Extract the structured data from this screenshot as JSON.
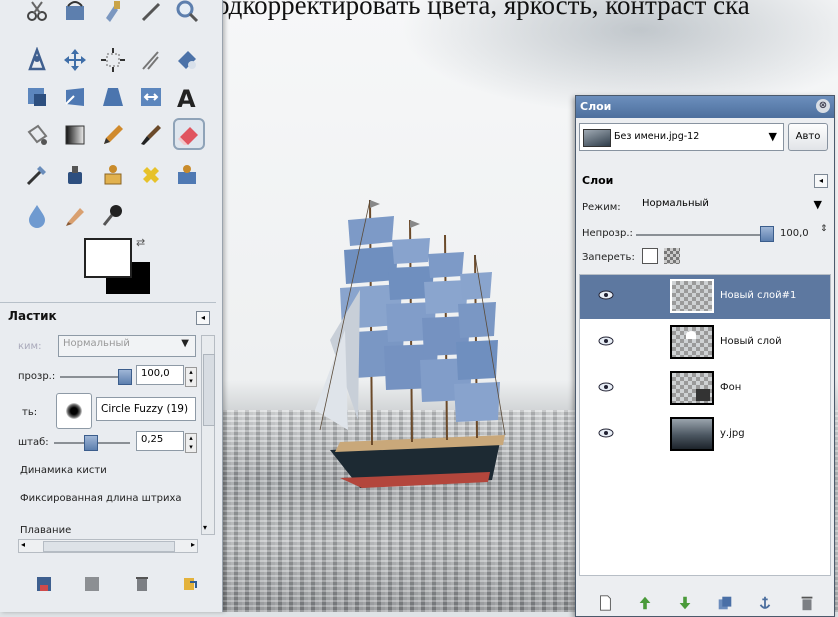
{
  "caption": "еще подкорректировать цвета, яркость, контраст ска",
  "tool_options": {
    "title": "Ластик",
    "mode_label": "ким:",
    "mode_value": "Нормальный",
    "opacity_label": "прозр.:",
    "opacity_value": "100,0",
    "brush_label": "ть:",
    "brush_value": "Circle Fuzzy (19)",
    "scale_label": "штаб:",
    "scale_value": "0,25",
    "dynamics_label": "Динамика кисти",
    "stroke_label": "Фиксированная длина штриха",
    "next_label": "Плавание"
  },
  "layers_dialog": {
    "title": "Слои",
    "image_name": "Без имени.jpg-12",
    "auto_button": "Авто",
    "section_title": "Слои",
    "mode_label": "Режим:",
    "mode_value": "Нормальный",
    "opacity_label": "Непрозр.:",
    "opacity_value": "100,0",
    "lock_label": "Запереть:",
    "layers": [
      {
        "name": "Новый слой#1",
        "selected": true
      },
      {
        "name": "Новый слой",
        "selected": false
      },
      {
        "name": "Фон",
        "selected": false
      },
      {
        "name": "у.jpg",
        "selected": false
      }
    ]
  },
  "colors": {
    "accent": "#5d78a0",
    "title_bar": "#4d6f9d",
    "eraser_highlight": "#e05560"
  },
  "icons": {
    "toolbox": [
      "scissors-icon",
      "paths-icon",
      "color-picker-icon",
      "zoom-icon",
      "measure-icon",
      "align-icon",
      "move-icon",
      "crop-icon",
      "rotate-icon",
      "scale-icon",
      "shear-icon",
      "perspective-icon",
      "flip-icon",
      "text-icon",
      "bucket-fill-icon",
      "blend-icon",
      "pencil-icon",
      "paintbrush-icon",
      "eraser-icon",
      "airbrush-icon",
      "ink-icon",
      "clone-icon",
      "heal-icon",
      "perspective-clone-icon",
      "blur-icon",
      "smudge-icon",
      "dodge-burn-icon"
    ],
    "tool_options_bottom": [
      "save-preset-icon",
      "restore-preset-icon",
      "delete-preset-icon",
      "reset-icon"
    ],
    "layers_bottom": [
      "new-layer-icon",
      "raise-layer-icon",
      "lower-layer-icon",
      "duplicate-layer-icon",
      "anchor-layer-icon",
      "delete-layer-icon"
    ]
  }
}
